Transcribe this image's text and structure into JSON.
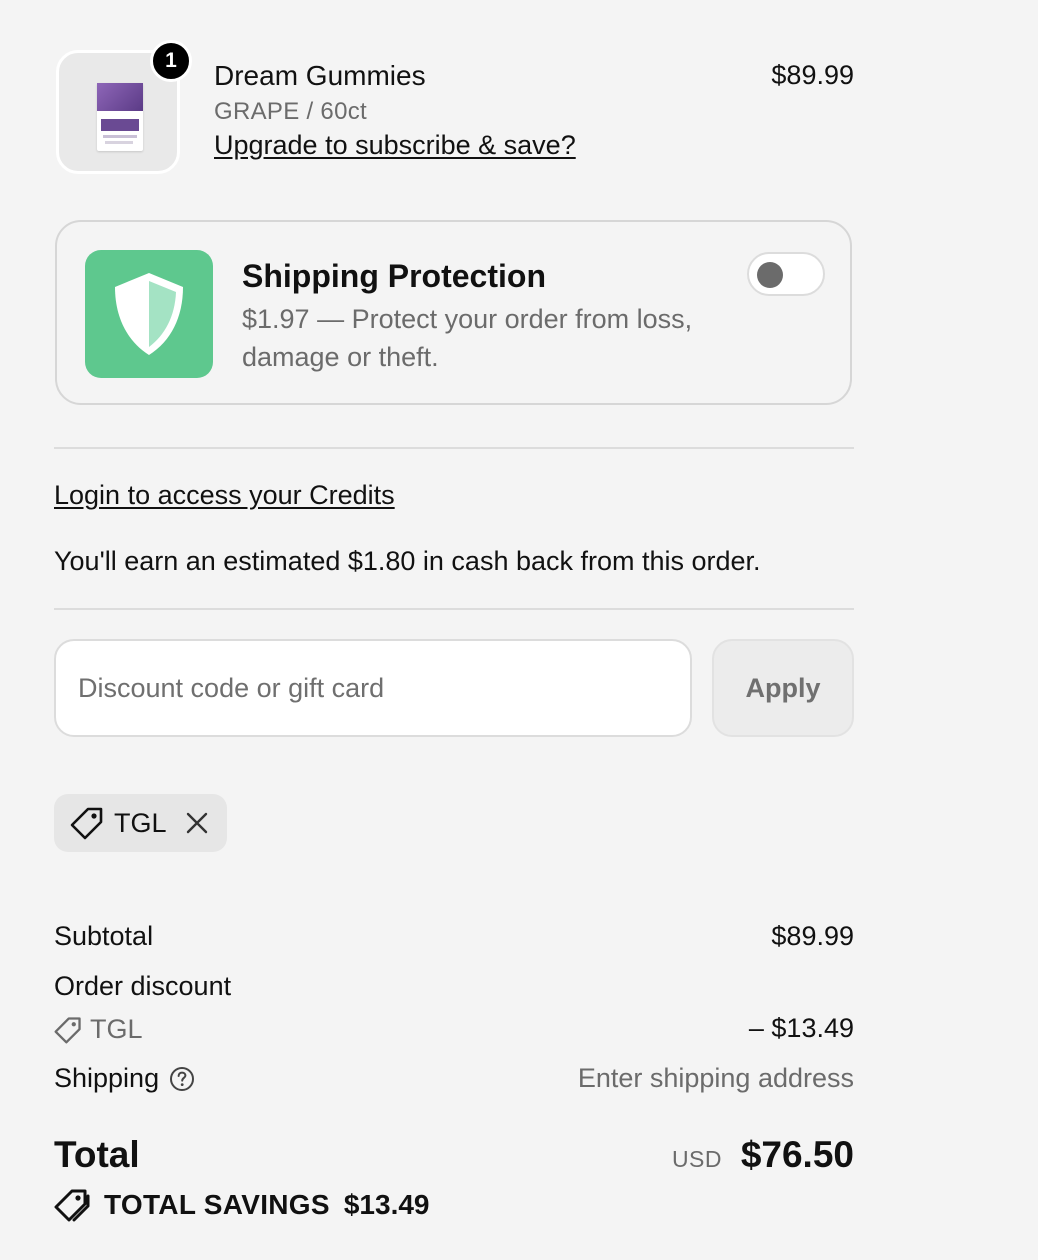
{
  "product": {
    "quantity": "1",
    "title": "Dream Gummies",
    "variant": "GRAPE / 60ct",
    "upgrade_link": "Upgrade to subscribe & save?",
    "price": "$89.99",
    "image_icon": "dream-gummies-package"
  },
  "shipping_protection": {
    "title": "Shipping Protection",
    "description": "$1.97 — Protect your order from loss, damage or theft.",
    "enabled": false,
    "icon": "shield-icon",
    "icon_color": "#5ec88e"
  },
  "credits": {
    "login_link": "Login to access your Credits",
    "cashback_text": "You'll earn an estimated $1.80 in cash back from this order."
  },
  "discount": {
    "placeholder": "Discount code or gift card",
    "value": "",
    "apply_label": "Apply",
    "applied_code": "TGL"
  },
  "summary": {
    "subtotal_label": "Subtotal",
    "subtotal_value": "$89.99",
    "order_discount_label": "Order discount",
    "discount_code": "TGL",
    "discount_value": "– $13.49",
    "shipping_label": "Shipping",
    "shipping_value": "Enter shipping address",
    "total_label": "Total",
    "total_currency": "USD",
    "total_value": "$76.50",
    "savings_label": "TOTAL SAVINGS",
    "savings_value": "$13.49"
  }
}
